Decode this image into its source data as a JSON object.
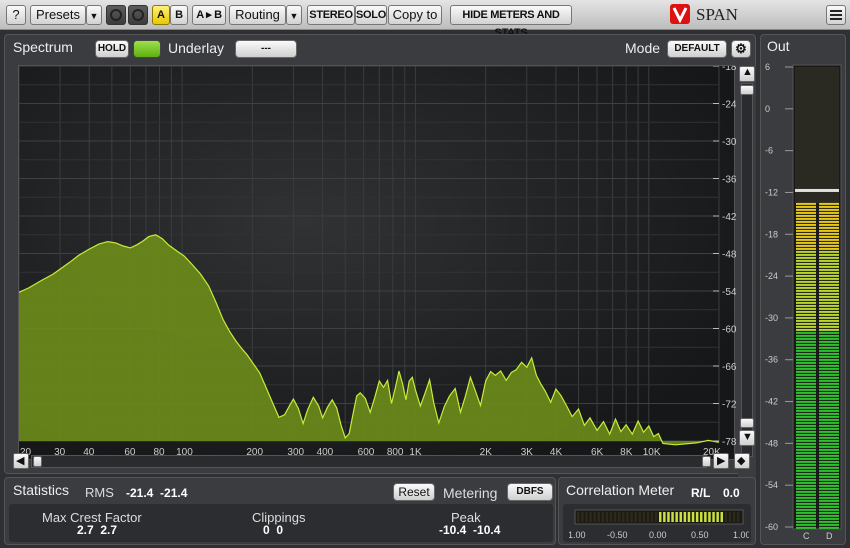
{
  "toolbar": {
    "help": "?",
    "presets": "Presets",
    "a": "A",
    "b": "B",
    "a_to_b": "A ▸ B",
    "routing": "Routing",
    "stereo": "STEREO",
    "solo": "SOLO",
    "copy_to": "Copy to",
    "hide_meters": "HIDE METERS AND STATS",
    "brand": "SPAN",
    "dropdown_icon": "chevron-down-icon",
    "undo_icon": "undo-icon",
    "redo_icon": "redo-icon",
    "menu_icon": "hamburger-menu-icon"
  },
  "spectrum": {
    "tab": "Spectrum",
    "hold": "HOLD",
    "underlay_label": "Underlay",
    "underlay_value": "---",
    "mode_label": "Mode",
    "mode_value": "DEFAULT",
    "fill_color": "#6b8a1a",
    "line_color": "#c8ec3a",
    "db_ticks": [
      "-18",
      "-24",
      "-30",
      "-36",
      "-42",
      "-48",
      "-54",
      "-60",
      "-66",
      "-72",
      "-78"
    ],
    "freq_ticks": [
      "20",
      "30",
      "40",
      "60",
      "80",
      "100",
      "200",
      "300",
      "400",
      "600",
      "800",
      "1K",
      "2K",
      "3K",
      "4K",
      "6K",
      "8K",
      "10K",
      "20K"
    ]
  },
  "statistics": {
    "tab": "Statistics",
    "rms_label": "RMS",
    "rms_values": "-21.4  -21.4",
    "reset": "Reset",
    "metering_label": "Metering",
    "metering_value": "DBFS",
    "crest_label": "Max Crest Factor",
    "crest_values": "2.7  2.7",
    "clippings_label": "Clippings",
    "clippings_values": "0  0",
    "peak_label": "Peak",
    "peak_values": "-10.4  -10.4"
  },
  "correlation": {
    "title": "Correlation Meter",
    "rl_label": "R/L",
    "rl_value": "0.0",
    "scale": [
      "-1.00",
      "-0.50",
      "0.00",
      "0.50",
      "1.00"
    ]
  },
  "out_meter": {
    "title": "Out",
    "scale": [
      "6",
      "0",
      "-6",
      "-12",
      "-18",
      "-24",
      "-30",
      "-36",
      "-42",
      "-48",
      "-54",
      "-60"
    ],
    "channels": [
      "C",
      "D"
    ],
    "level_db": -13.5,
    "peak_db": -11.5
  }
}
